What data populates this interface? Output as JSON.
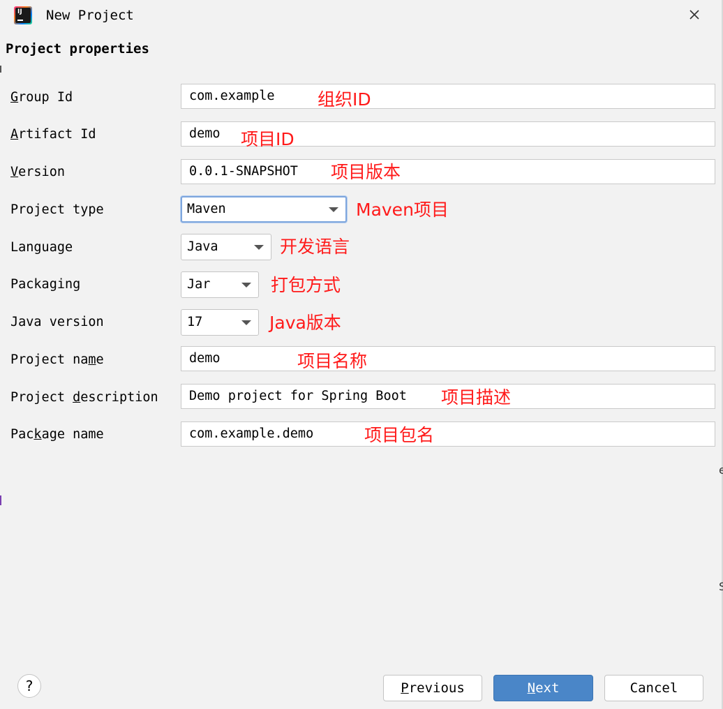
{
  "window": {
    "title": "New Project",
    "close_icon": "close-icon",
    "app_icon": "intellij-idea-icon"
  },
  "section_title": "Project properties",
  "fields": {
    "group_id": {
      "label_pre": "",
      "label_mnemonic": "G",
      "label_post": "roup Id",
      "value": "com.example",
      "note": "组织ID"
    },
    "artifact_id": {
      "label_pre": "",
      "label_mnemonic": "A",
      "label_post": "rtifact Id",
      "value": "demo",
      "note": "项目ID"
    },
    "version": {
      "label_pre": "",
      "label_mnemonic": "V",
      "label_post": "ersion",
      "value": "0.0.1-SNAPSHOT",
      "note": "项目版本"
    },
    "project_type": {
      "label": "Project type",
      "value": "Maven",
      "note": "Maven项目"
    },
    "language": {
      "label": "Language",
      "value": "Java",
      "note": "开发语言"
    },
    "packaging": {
      "label": "Packaging",
      "value": "Jar",
      "note": "打包方式"
    },
    "java_version": {
      "label": "Java version",
      "value": "17",
      "note": "Java版本"
    },
    "project_name": {
      "label_pre": "Project na",
      "label_mnemonic": "m",
      "label_post": "e",
      "value": "demo",
      "note": "项目名称"
    },
    "project_description": {
      "label_pre": "Project ",
      "label_mnemonic": "d",
      "label_post": "escription",
      "value": "Demo project for Spring Boot",
      "note": "项目描述"
    },
    "package_name": {
      "label_pre": "Pac",
      "label_mnemonic": "k",
      "label_post": "age name",
      "value": "com.example.demo",
      "note": "项目包名"
    }
  },
  "buttons": {
    "help": "?",
    "previous": {
      "mnemonic": "P",
      "rest": "revious"
    },
    "next": {
      "mnemonic": "N",
      "rest": "ext"
    },
    "cancel": "Cancel"
  },
  "colors": {
    "annotation": "#ff1a1a",
    "primary_button": "#4a86c8",
    "focus_border": "#7ea6dd"
  },
  "edge_fragments": [
    "e",
    "S"
  ]
}
